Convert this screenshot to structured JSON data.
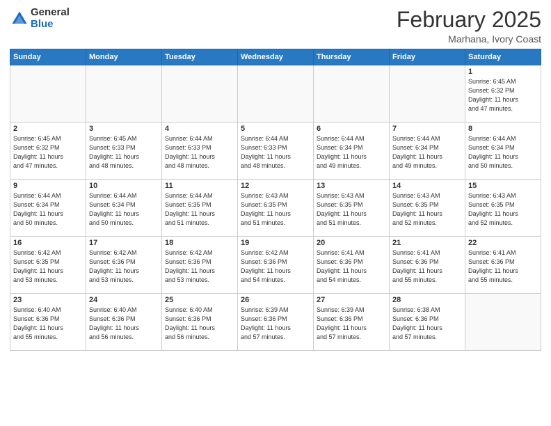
{
  "header": {
    "logo_general": "General",
    "logo_blue": "Blue",
    "month": "February 2025",
    "location": "Marhana, Ivory Coast"
  },
  "weekdays": [
    "Sunday",
    "Monday",
    "Tuesday",
    "Wednesday",
    "Thursday",
    "Friday",
    "Saturday"
  ],
  "weeks": [
    [
      {
        "num": "",
        "info": ""
      },
      {
        "num": "",
        "info": ""
      },
      {
        "num": "",
        "info": ""
      },
      {
        "num": "",
        "info": ""
      },
      {
        "num": "",
        "info": ""
      },
      {
        "num": "",
        "info": ""
      },
      {
        "num": "1",
        "info": "Sunrise: 6:45 AM\nSunset: 6:32 PM\nDaylight: 11 hours\nand 47 minutes."
      }
    ],
    [
      {
        "num": "2",
        "info": "Sunrise: 6:45 AM\nSunset: 6:32 PM\nDaylight: 11 hours\nand 47 minutes."
      },
      {
        "num": "3",
        "info": "Sunrise: 6:45 AM\nSunset: 6:33 PM\nDaylight: 11 hours\nand 48 minutes."
      },
      {
        "num": "4",
        "info": "Sunrise: 6:44 AM\nSunset: 6:33 PM\nDaylight: 11 hours\nand 48 minutes."
      },
      {
        "num": "5",
        "info": "Sunrise: 6:44 AM\nSunset: 6:33 PM\nDaylight: 11 hours\nand 48 minutes."
      },
      {
        "num": "6",
        "info": "Sunrise: 6:44 AM\nSunset: 6:34 PM\nDaylight: 11 hours\nand 49 minutes."
      },
      {
        "num": "7",
        "info": "Sunrise: 6:44 AM\nSunset: 6:34 PM\nDaylight: 11 hours\nand 49 minutes."
      },
      {
        "num": "8",
        "info": "Sunrise: 6:44 AM\nSunset: 6:34 PM\nDaylight: 11 hours\nand 50 minutes."
      }
    ],
    [
      {
        "num": "9",
        "info": "Sunrise: 6:44 AM\nSunset: 6:34 PM\nDaylight: 11 hours\nand 50 minutes."
      },
      {
        "num": "10",
        "info": "Sunrise: 6:44 AM\nSunset: 6:34 PM\nDaylight: 11 hours\nand 50 minutes."
      },
      {
        "num": "11",
        "info": "Sunrise: 6:44 AM\nSunset: 6:35 PM\nDaylight: 11 hours\nand 51 minutes."
      },
      {
        "num": "12",
        "info": "Sunrise: 6:43 AM\nSunset: 6:35 PM\nDaylight: 11 hours\nand 51 minutes."
      },
      {
        "num": "13",
        "info": "Sunrise: 6:43 AM\nSunset: 6:35 PM\nDaylight: 11 hours\nand 51 minutes."
      },
      {
        "num": "14",
        "info": "Sunrise: 6:43 AM\nSunset: 6:35 PM\nDaylight: 11 hours\nand 52 minutes."
      },
      {
        "num": "15",
        "info": "Sunrise: 6:43 AM\nSunset: 6:35 PM\nDaylight: 11 hours\nand 52 minutes."
      }
    ],
    [
      {
        "num": "16",
        "info": "Sunrise: 6:42 AM\nSunset: 6:35 PM\nDaylight: 11 hours\nand 53 minutes."
      },
      {
        "num": "17",
        "info": "Sunrise: 6:42 AM\nSunset: 6:36 PM\nDaylight: 11 hours\nand 53 minutes."
      },
      {
        "num": "18",
        "info": "Sunrise: 6:42 AM\nSunset: 6:36 PM\nDaylight: 11 hours\nand 53 minutes."
      },
      {
        "num": "19",
        "info": "Sunrise: 6:42 AM\nSunset: 6:36 PM\nDaylight: 11 hours\nand 54 minutes."
      },
      {
        "num": "20",
        "info": "Sunrise: 6:41 AM\nSunset: 6:36 PM\nDaylight: 11 hours\nand 54 minutes."
      },
      {
        "num": "21",
        "info": "Sunrise: 6:41 AM\nSunset: 6:36 PM\nDaylight: 11 hours\nand 55 minutes."
      },
      {
        "num": "22",
        "info": "Sunrise: 6:41 AM\nSunset: 6:36 PM\nDaylight: 11 hours\nand 55 minutes."
      }
    ],
    [
      {
        "num": "23",
        "info": "Sunrise: 6:40 AM\nSunset: 6:36 PM\nDaylight: 11 hours\nand 55 minutes."
      },
      {
        "num": "24",
        "info": "Sunrise: 6:40 AM\nSunset: 6:36 PM\nDaylight: 11 hours\nand 56 minutes."
      },
      {
        "num": "25",
        "info": "Sunrise: 6:40 AM\nSunset: 6:36 PM\nDaylight: 11 hours\nand 56 minutes."
      },
      {
        "num": "26",
        "info": "Sunrise: 6:39 AM\nSunset: 6:36 PM\nDaylight: 11 hours\nand 57 minutes."
      },
      {
        "num": "27",
        "info": "Sunrise: 6:39 AM\nSunset: 6:36 PM\nDaylight: 11 hours\nand 57 minutes."
      },
      {
        "num": "28",
        "info": "Sunrise: 6:38 AM\nSunset: 6:36 PM\nDaylight: 11 hours\nand 57 minutes."
      },
      {
        "num": "",
        "info": ""
      }
    ]
  ]
}
